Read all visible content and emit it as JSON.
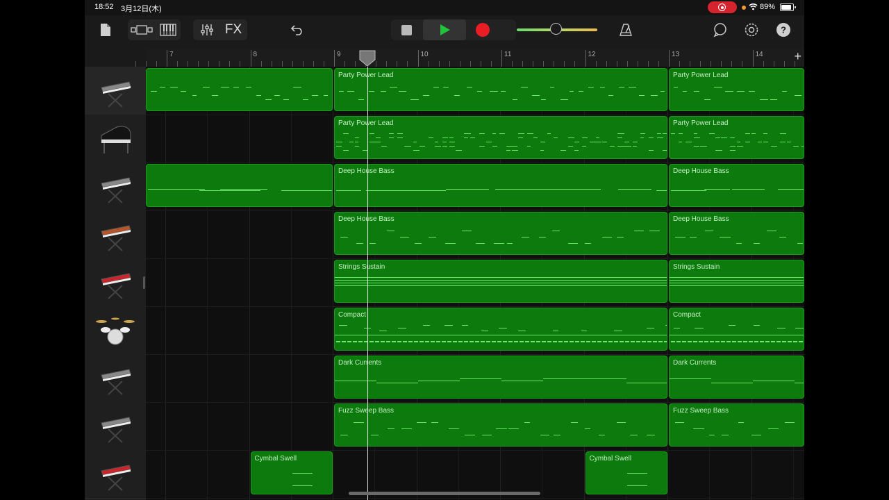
{
  "status": {
    "time": "18:52",
    "date": "3月12日(木)",
    "battery": "89%",
    "battery_level": 0.89
  },
  "toolbar": {
    "fx_label": "FX",
    "icons": [
      "document-icon",
      "view-toggle-icon",
      "keyboard-icon",
      "mixer-icon",
      "undo-icon",
      "stop-icon",
      "play-icon",
      "record-icon",
      "metronome-icon",
      "loop-icon",
      "settings-icon",
      "help-icon"
    ],
    "master_volume": 0.48
  },
  "ruler": {
    "bars": [
      "7",
      "8",
      "9",
      "10",
      "11",
      "12",
      "13",
      "14"
    ],
    "add_label": "+"
  },
  "colors": {
    "region": "#0d7a0d",
    "region_border": "#1b9a1b",
    "note": "#6de96d",
    "record": "#ea1d24",
    "play": "#22c33a"
  },
  "tracks": [
    {
      "instrument": "synth-keyboard-icon",
      "regions": [
        {
          "label": "",
          "start": 6.75,
          "end": 9.0,
          "pattern": "lead"
        },
        {
          "label": "Party Power Lead",
          "start": 9.0,
          "end": 13.0,
          "pattern": "lead"
        },
        {
          "label": "Party Power Lead",
          "start": 13.0,
          "end": 14.65,
          "pattern": "lead"
        }
      ]
    },
    {
      "instrument": "grand-piano-icon",
      "regions": [
        {
          "label": "Party Power Lead",
          "start": 9.0,
          "end": 13.0,
          "pattern": "dense"
        },
        {
          "label": "Party Power Lead",
          "start": 13.0,
          "end": 14.65,
          "pattern": "dense"
        }
      ]
    },
    {
      "instrument": "synth-keyboard-icon",
      "regions": [
        {
          "label": "",
          "start": 6.75,
          "end": 9.0,
          "pattern": "bass-line"
        },
        {
          "label": "Deep House Bass",
          "start": 9.0,
          "end": 13.0,
          "pattern": "bass-line"
        },
        {
          "label": "Deep House Bass",
          "start": 13.0,
          "end": 14.65,
          "pattern": "bass-line"
        }
      ]
    },
    {
      "instrument": "analog-synth-icon",
      "regions": [
        {
          "label": "Deep House Bass",
          "start": 9.0,
          "end": 13.0,
          "pattern": "bass-dash"
        },
        {
          "label": "Deep House Bass",
          "start": 13.0,
          "end": 14.65,
          "pattern": "bass-dash"
        }
      ]
    },
    {
      "instrument": "red-keyboard-icon",
      "regions": [
        {
          "label": "Strings Sustain",
          "start": 9.0,
          "end": 13.0,
          "pattern": "sustain"
        },
        {
          "label": "Strings Sustain",
          "start": 13.0,
          "end": 14.65,
          "pattern": "sustain"
        }
      ]
    },
    {
      "instrument": "drum-kit-icon",
      "regions": [
        {
          "label": "Compact",
          "start": 9.0,
          "end": 13.0,
          "pattern": "drums"
        },
        {
          "label": "Compact",
          "start": 13.0,
          "end": 14.65,
          "pattern": "drums"
        }
      ]
    },
    {
      "instrument": "synth-keyboard-icon",
      "regions": [
        {
          "label": "Dark Currents",
          "start": 9.0,
          "end": 13.0,
          "pattern": "pad"
        },
        {
          "label": "Dark Currents",
          "start": 13.0,
          "end": 14.65,
          "pattern": "pad"
        }
      ]
    },
    {
      "instrument": "synth-keyboard-icon",
      "regions": [
        {
          "label": "Fuzz Sweep Bass",
          "start": 9.0,
          "end": 13.0,
          "pattern": "bass-dash"
        },
        {
          "label": "Fuzz Sweep Bass",
          "start": 13.0,
          "end": 14.65,
          "pattern": "bass-dash"
        }
      ]
    },
    {
      "instrument": "red-keyboard-icon",
      "regions": [
        {
          "label": "Cymbal Swell",
          "start": 8.0,
          "end": 9.0,
          "pattern": "swell"
        },
        {
          "label": "Cymbal Swell",
          "start": 12.0,
          "end": 13.0,
          "pattern": "swell"
        }
      ]
    }
  ],
  "playhead_bar": 9.4
}
